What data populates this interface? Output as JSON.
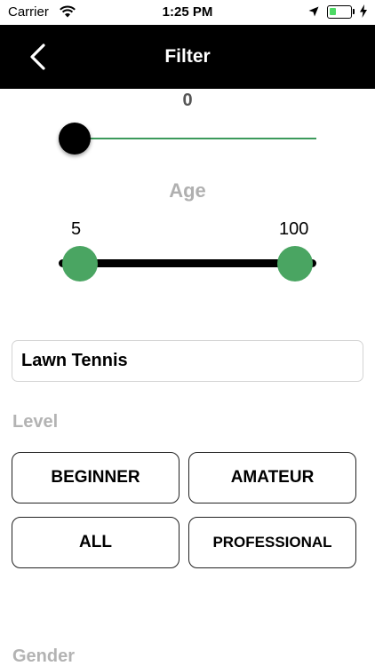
{
  "status_bar": {
    "carrier": "Carrier",
    "time": "1:25 PM",
    "battery_level": 0.35,
    "battery_color": "#4cd964"
  },
  "nav": {
    "title": "Filter",
    "back_icon": "chevron-left-icon"
  },
  "distance_slider": {
    "value": "0",
    "value_num": 0,
    "track_color": "#3c9a5b",
    "thumb_color": "#000000"
  },
  "age": {
    "label": "Age",
    "min_label": "5",
    "max_label": "100",
    "min_value": 5,
    "max_value": 100,
    "thumb_color": "#4aa562"
  },
  "sport": {
    "value": "Lawn Tennis"
  },
  "level": {
    "label": "Level",
    "options": [
      "BEGINNER",
      "AMATEUR",
      "ALL",
      "PROFESSIONAL"
    ]
  },
  "gender": {
    "label": "Gender"
  }
}
